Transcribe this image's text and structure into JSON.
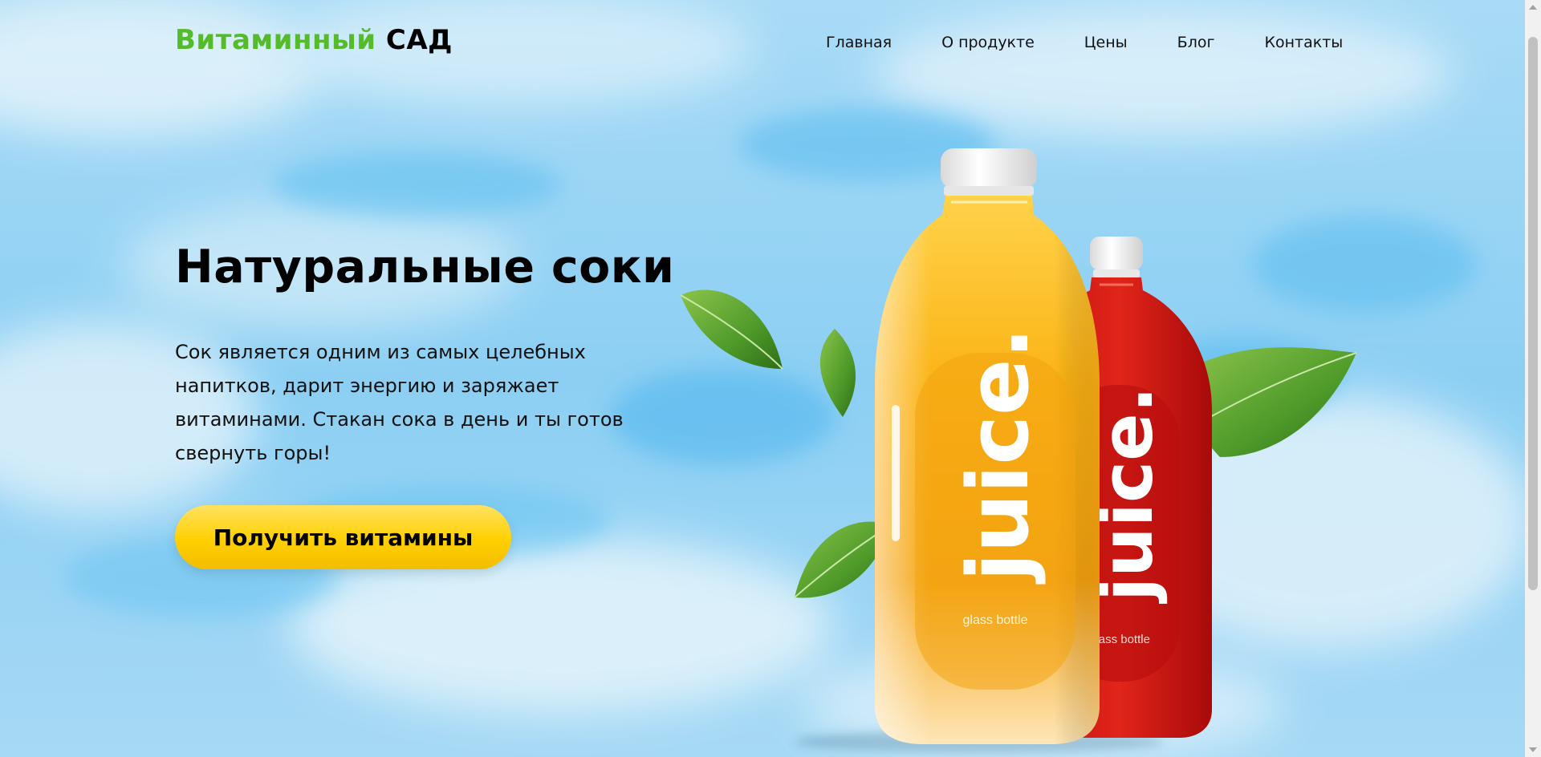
{
  "colors": {
    "logo_accent": "#55bb2a",
    "cta_button": "#ffd000",
    "sky": "#9fd6f5"
  },
  "header": {
    "logo_part1": "Витаминный",
    "logo_part2": "САД",
    "nav": [
      {
        "label": "Главная"
      },
      {
        "label": "О продукте"
      },
      {
        "label": "Цены"
      },
      {
        "label": "Блог"
      },
      {
        "label": "Контакты"
      }
    ]
  },
  "hero": {
    "title": "Натуральные соки",
    "description": "Сок является одним из самых целебных напитков, дарит энергию и заряжает витаминами. Стакан сока в день и ты готов свернуть горы!",
    "cta_label": "Получить витамины"
  },
  "product": {
    "bottle1": {
      "brand": "juice.",
      "caption": "glass bottle"
    },
    "bottle2": {
      "brand": "juice.",
      "caption": "glass bottle"
    },
    "icons": [
      "leaf-icon"
    ]
  }
}
